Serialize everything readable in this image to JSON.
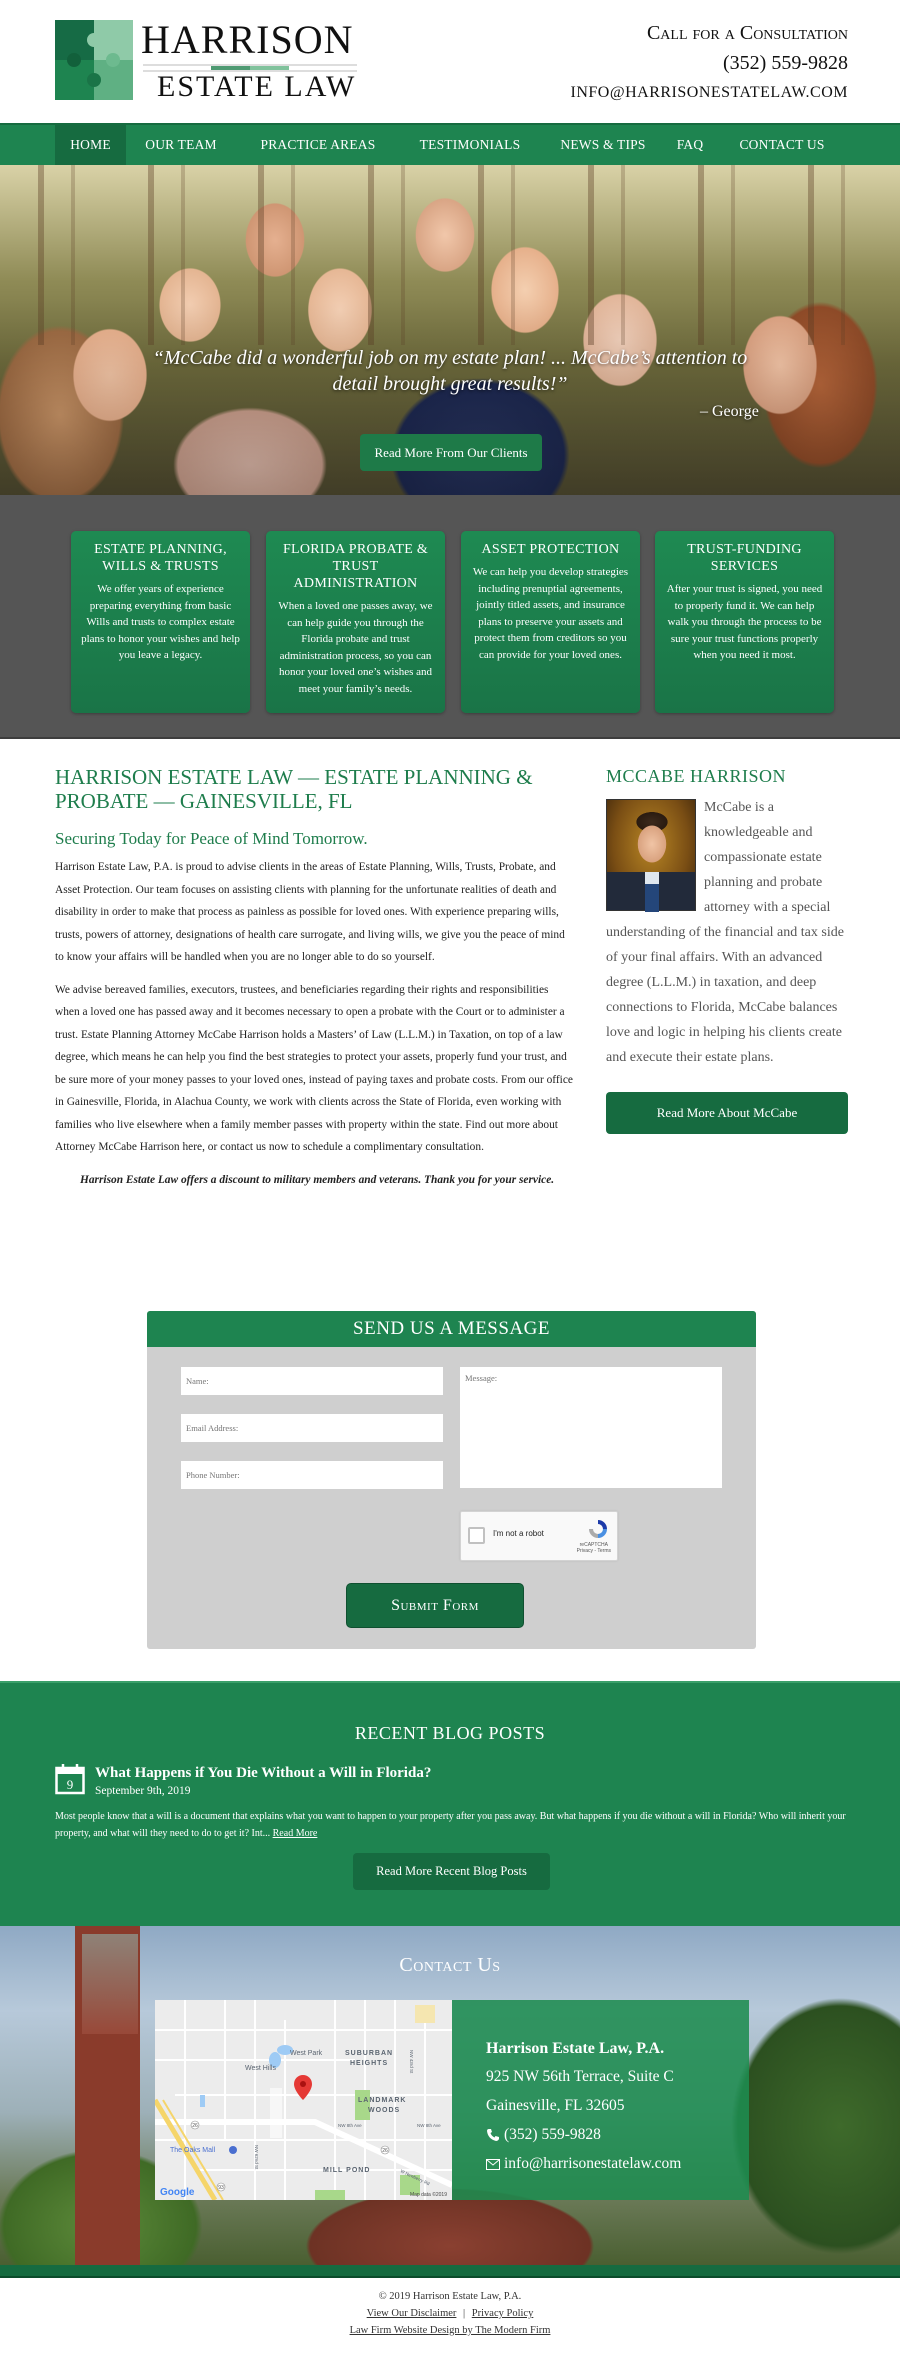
{
  "header": {
    "logo_title": "HARRISON",
    "logo_subtitle": "ESTATE LAW",
    "cta_label": "Call for a Consultation",
    "phone": "(352) 559-9828",
    "email": "INFO@HARRISONESTATELAW.COM"
  },
  "nav": {
    "items": [
      {
        "label": "HOME",
        "active": true
      },
      {
        "label": "OUR TEAM"
      },
      {
        "label": "PRACTICE AREAS"
      },
      {
        "label": "TESTIMONIALS"
      },
      {
        "label": "NEWS & TIPS"
      },
      {
        "label": "FAQ"
      },
      {
        "label": "CONTACT US"
      }
    ]
  },
  "hero": {
    "quote": "“McCabe did a wonderful job on my estate plan! ... McCabe’s attention to detail brought great results!”",
    "author": "– George",
    "button_label": "Read More From Our Clients"
  },
  "services": [
    {
      "title": "ESTATE PLANNING, WILLS & TRUSTS",
      "text": "We offer years of experience preparing everything from basic Wills and trusts to complex estate plans to honor your wishes and help you leave a legacy."
    },
    {
      "title": "FLORIDA PROBATE & TRUST ADMINISTRATION",
      "text": "When a loved one passes away, we can help guide you through the Florida probate and trust administration process, so you can honor your loved one’s wishes and meet your family’s needs."
    },
    {
      "title": "ASSET PROTECTION",
      "text": "We can help you develop strategies including prenuptial agreements, jointly titled assets, and insurance plans to preserve your assets and protect them from creditors so you can provide for your loved ones."
    },
    {
      "title": "TRUST-FUNDING SERVICES",
      "text": "After your trust is signed, you need to properly fund it. We can help walk you through the process to be sure your trust functions properly when you need it most."
    }
  ],
  "main": {
    "heading": "HARRISON ESTATE LAW — ESTATE PLANNING & PROBATE — GAINESVILLE, FL",
    "subheading": "Securing Today for Peace of Mind Tomorrow.",
    "paragraphs": [
      "Harrison Estate Law, P.A. is proud to advise clients in the areas of Estate Planning, Wills, Trusts, Probate, and Asset Protection. Our team focuses on assisting clients with planning for the unfortunate realities of death and disability in order to make that process as painless as possible for loved ones. With experience preparing wills, trusts, powers of attorney, designations of health care surrogate, and living wills, we give you the peace of mind to know your affairs will be handled when you are no longer able to do so yourself.",
      "We advise bereaved families, executors, trustees, and beneficiaries regarding their rights and responsibilities when a loved one has passed away and it becomes necessary to open a probate with the Court or to administer a trust. Estate Planning Attorney McCabe Harrison holds a Masters’ of Law (L.L.M.) in Taxation, on top of a law degree, which means he can help you find the best strategies to protect your assets, properly fund your trust, and be sure more of your money passes to your loved ones, instead of paying taxes and probate costs. From our office in Gainesville, Florida, in Alachua County, we work with clients across the State of Florida, even working with families who live elsewhere when a family member passes with property within the state. Find out more about Attorney McCabe Harrison here, or contact us now to schedule a complimentary consultation."
    ],
    "promo": "Harrison Estate Law offers a discount to military members and veterans. Thank you for your service."
  },
  "sidebar": {
    "heading": "MCCABE HARRISON",
    "bio": "McCabe is a knowledgeable and compassionate estate planning and probate attorney with a special understanding of the financial and tax side of your final affairs. With an advanced degree (L.L.M.) in taxation, and deep connections to Florida, McCabe balances love and logic in helping his clients create and execute their estate plans.",
    "button_label": "Read More About McCabe"
  },
  "form": {
    "title": "SEND US A MESSAGE",
    "name_placeholder": "Name:",
    "email_placeholder": "Email Address:",
    "phone_placeholder": "Phone Number:",
    "message_placeholder": "Message:",
    "captcha_label": "I'm not a robot",
    "captcha_brand": "reCAPTCHA",
    "captcha_links": "Privacy - Terms",
    "submit_label": "Submit Form"
  },
  "blog": {
    "heading": "RECENT BLOG POSTS",
    "posts": [
      {
        "day": "9",
        "title": "What Happens if You Die Without a Will in Florida?",
        "date": "September 9th, 2019",
        "excerpt": "Most people know that a will is a document that explains what you want to happen to your property after you pass away. But what happens if you die without a will in Florida? Who will inherit your property, and what will they need to do to get it? Int...",
        "read_more": "Read More"
      }
    ],
    "button_label": "Read More Recent Blog Posts"
  },
  "contact": {
    "heading": "Contact Us",
    "firm": "Harrison Estate Law, P.A.",
    "address1": "925 NW 56th Terrace, Suite C",
    "address2": "Gainesville, FL 32605",
    "phone": "(352) 559-9828",
    "email": "info@harrisonestatelaw.com",
    "map": {
      "labels": [
        "West Park",
        "SUBURBAN",
        "HEIGHTS",
        "West Hills",
        "LANDMARK",
        "WOODS",
        "NW 8th Ave",
        "NW 8th Ave",
        "The Oaks Mall",
        "MILL POND",
        "NW 43rd St",
        "NW 62nd St",
        "W Newberry Rd",
        "26",
        "26",
        "93"
      ],
      "google": "Google",
      "attribution": "Map data ©2019"
    }
  },
  "footer": {
    "copyright": "© 2019 Harrison Estate Law, P.A.",
    "disclaimer": "View Our Disclaimer",
    "separator": "|",
    "privacy": "Privacy Policy",
    "credit": "Law Firm Website Design by The Modern Firm"
  },
  "colors": {
    "brand_green": "#1e8450",
    "dark_green": "#166b40",
    "heading_green": "#1e7d4c",
    "services_bg": "#555555",
    "form_bg": "#cfcfcf"
  }
}
